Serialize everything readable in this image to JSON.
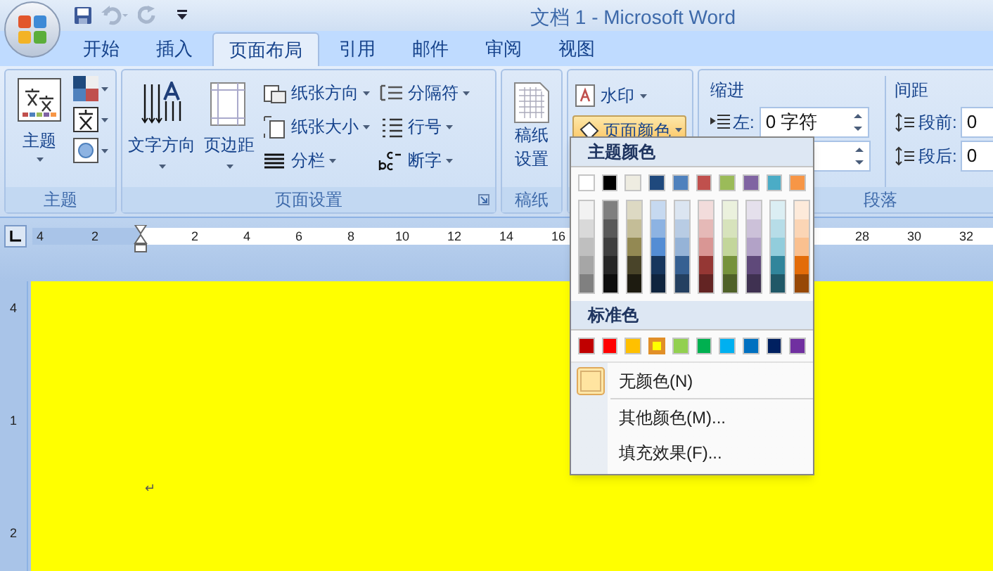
{
  "window": {
    "title": "文档 1 - Microsoft Word"
  },
  "tabs": [
    {
      "label": "开始",
      "selected": false
    },
    {
      "label": "插入",
      "selected": false
    },
    {
      "label": "页面布局",
      "selected": true
    },
    {
      "label": "引用",
      "selected": false
    },
    {
      "label": "邮件",
      "selected": false
    },
    {
      "label": "审阅",
      "selected": false
    },
    {
      "label": "视图",
      "selected": false
    }
  ],
  "theme_group": {
    "button": "主题",
    "label": "主题"
  },
  "page_setup_group": {
    "big_buttons": [
      "文字方向",
      "页边距"
    ],
    "small_buttons": [
      "纸张方向",
      "纸张大小",
      "分栏",
      "分隔符",
      "行号",
      "断字"
    ],
    "label": "页面设置"
  },
  "paper_group": {
    "button_lines": [
      "稿纸",
      "设置"
    ],
    "label": "稿纸"
  },
  "background_group": {
    "watermark": "水印",
    "page_color": {
      "label": "页面颜色",
      "expanded": true
    }
  },
  "paragraph_group": {
    "indent_label": "缩进",
    "left_label": "左:",
    "left_value": "0 字符",
    "spacing_label": "间距",
    "before_label": "段前:",
    "before_value": "0",
    "after_label": "段后:",
    "after_value": "0",
    "label": "段落"
  },
  "ruler": {
    "left_numbers": [
      "4",
      "2"
    ],
    "numbers": [
      "2",
      "4",
      "6",
      "8",
      "10",
      "12",
      "14",
      "16"
    ],
    "right_numbers": [
      "28",
      "30",
      "32"
    ]
  },
  "vertical_ruler": [
    "4",
    "1",
    "2"
  ],
  "document": {
    "paragraph_mark": "↵"
  },
  "color_menu": {
    "theme_header": "主题颜色",
    "theme_colors": [
      {
        "color": "#ffffff",
        "selected": false
      },
      {
        "color": "#000000",
        "selected": false
      },
      {
        "color": "#eeece1",
        "selected": false
      },
      {
        "color": "#1f497d",
        "selected": false
      },
      {
        "color": "#4f81bd",
        "selected": false
      },
      {
        "color": "#c0504d",
        "selected": false
      },
      {
        "color": "#9bbb59",
        "selected": false
      },
      {
        "color": "#8064a2",
        "selected": false
      },
      {
        "color": "#4bacc6",
        "selected": false
      },
      {
        "color": "#f79646",
        "selected": false
      }
    ],
    "theme_shades": [
      [
        {
          "color": "#f2f2f2",
          "selected": false
        },
        {
          "color": "#d9d9d9",
          "selected": false
        },
        {
          "color": "#bfbfbf",
          "selected": false
        },
        {
          "color": "#a6a6a6",
          "selected": false
        },
        {
          "color": "#808080",
          "selected": false
        }
      ],
      [
        {
          "color": "#7f7f7f",
          "selected": false
        },
        {
          "color": "#595959",
          "selected": false
        },
        {
          "color": "#3f3f3f",
          "selected": false
        },
        {
          "color": "#262626",
          "selected": false
        },
        {
          "color": "#0d0d0d",
          "selected": false
        }
      ],
      [
        {
          "color": "#ddd9c3",
          "selected": false
        },
        {
          "color": "#c4bd97",
          "selected": false
        },
        {
          "color": "#938953",
          "selected": false
        },
        {
          "color": "#494429",
          "selected": false
        },
        {
          "color": "#1d1b10",
          "selected": false
        }
      ],
      [
        {
          "color": "#c6d9f0",
          "selected": false
        },
        {
          "color": "#8db3e2",
          "selected": false
        },
        {
          "color": "#548dd4",
          "selected": false
        },
        {
          "color": "#17365d",
          "selected": false
        },
        {
          "color": "#0f243e",
          "selected": false
        }
      ],
      [
        {
          "color": "#dbe5f1",
          "selected": false
        },
        {
          "color": "#b8cce4",
          "selected": false
        },
        {
          "color": "#95b3d7",
          "selected": false
        },
        {
          "color": "#366092",
          "selected": false
        },
        {
          "color": "#244061",
          "selected": false
        }
      ],
      [
        {
          "color": "#f2dcdb",
          "selected": false
        },
        {
          "color": "#e5b9b7",
          "selected": false
        },
        {
          "color": "#d99694",
          "selected": false
        },
        {
          "color": "#953734",
          "selected": false
        },
        {
          "color": "#632423",
          "selected": false
        }
      ],
      [
        {
          "color": "#ebf1dd",
          "selected": false
        },
        {
          "color": "#d7e3bc",
          "selected": false
        },
        {
          "color": "#c3d69b",
          "selected": false
        },
        {
          "color": "#76923c",
          "selected": false
        },
        {
          "color": "#4f6128",
          "selected": false
        }
      ],
      [
        {
          "color": "#e5e0ec",
          "selected": false
        },
        {
          "color": "#ccc1d9",
          "selected": false
        },
        {
          "color": "#b2a2c7",
          "selected": false
        },
        {
          "color": "#5f497a",
          "selected": false
        },
        {
          "color": "#3f3151",
          "selected": false
        }
      ],
      [
        {
          "color": "#dbeef3",
          "selected": false
        },
        {
          "color": "#b7dde8",
          "selected": false
        },
        {
          "color": "#92cddc",
          "selected": false
        },
        {
          "color": "#31859b",
          "selected": false
        },
        {
          "color": "#205867",
          "selected": false
        }
      ],
      [
        {
          "color": "#fdeada",
          "selected": false
        },
        {
          "color": "#fbd5b5",
          "selected": false
        },
        {
          "color": "#fac08f",
          "selected": false
        },
        {
          "color": "#e36c09",
          "selected": false
        },
        {
          "color": "#974806",
          "selected": false
        }
      ]
    ],
    "standard_header": "标准色",
    "standard_colors": [
      {
        "color": "#c00000",
        "selected": false
      },
      {
        "color": "#ff0000",
        "selected": false
      },
      {
        "color": "#ffc000",
        "selected": false
      },
      {
        "color": "#ffff00",
        "selected": true
      },
      {
        "color": "#92d050",
        "selected": false
      },
      {
        "color": "#00b050",
        "selected": false
      },
      {
        "color": "#00b0f0",
        "selected": false
      },
      {
        "color": "#0070c0",
        "selected": false
      },
      {
        "color": "#002060",
        "selected": false
      },
      {
        "color": "#7030a0",
        "selected": false
      }
    ],
    "items": [
      {
        "kind": "swatch",
        "label": "无颜色(N)"
      },
      {
        "kind": "plain",
        "label": "其他颜色(M)..."
      },
      {
        "kind": "plain",
        "label": "填充效果(F)..."
      }
    ]
  }
}
